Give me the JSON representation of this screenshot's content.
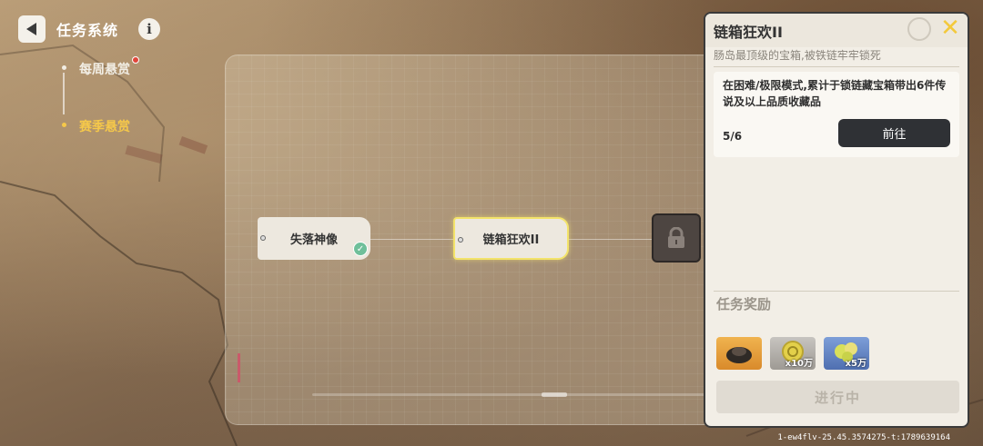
{
  "header": {
    "title": "任务系统",
    "info_glyph": "i"
  },
  "nav": {
    "items": [
      {
        "label": "每周悬赏",
        "active": false,
        "has_badge": true
      },
      {
        "label": "赛季悬赏",
        "active": true,
        "has_badge": false
      }
    ]
  },
  "map": {
    "nodes": [
      {
        "label": "失落神像",
        "state": "completed"
      },
      {
        "label": "链箱狂欢II",
        "state": "selected"
      },
      {
        "label": "",
        "state": "locked"
      }
    ]
  },
  "detail": {
    "title": "链箱狂欢II",
    "subtitle": "肠岛最顶级的宝箱,被铁链牢牢锁死",
    "task_description": "在困难/极限模式,累计于锁链藏宝箱带出6件传说及以上品质收藏品",
    "progress": "5/6",
    "go_button": "前往",
    "close_glyph": "✕",
    "rewards_title": "任务奖励",
    "rewards": [
      {
        "icon": "item-icon",
        "qty": ""
      },
      {
        "icon": "coin-icon",
        "qty": "x10万"
      },
      {
        "icon": "coin-stack-icon",
        "qty": "x5万"
      }
    ],
    "status_button": "进行中"
  },
  "footer": {
    "build": "1-ew4flv-25.45.3574275-t:1789639164"
  },
  "colors": {
    "accent_yellow": "#f5c84a",
    "selected_border": "#f3e36a",
    "completed_check": "#6fbf9a",
    "badge_red": "#e0463a"
  }
}
